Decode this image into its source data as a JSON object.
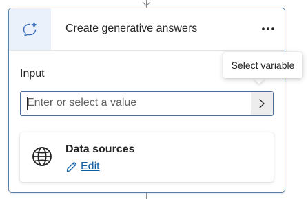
{
  "node": {
    "title": "Create generative answers",
    "more_label": "⋯"
  },
  "input_section": {
    "label": "Input",
    "placeholder": "Enter or select a value",
    "value": ""
  },
  "tooltip": {
    "text": "Select variable"
  },
  "data_sources": {
    "title": "Data sources",
    "edit_label": "Edit"
  },
  "icons": {
    "node_icon": "sparkle-chat-icon",
    "more": "more-horizontal-icon",
    "select_variable": "chevron-right-icon",
    "data_sources": "globe-icon",
    "edit": "pencil-icon",
    "connector_top": "arrow-down-icon"
  },
  "colors": {
    "card_border": "#5a7fa6",
    "icon_tile_bg": "#eaf1fb",
    "input_border": "#4d6f95",
    "link": "#115ea3",
    "accent_icon": "#3b6fb6"
  }
}
